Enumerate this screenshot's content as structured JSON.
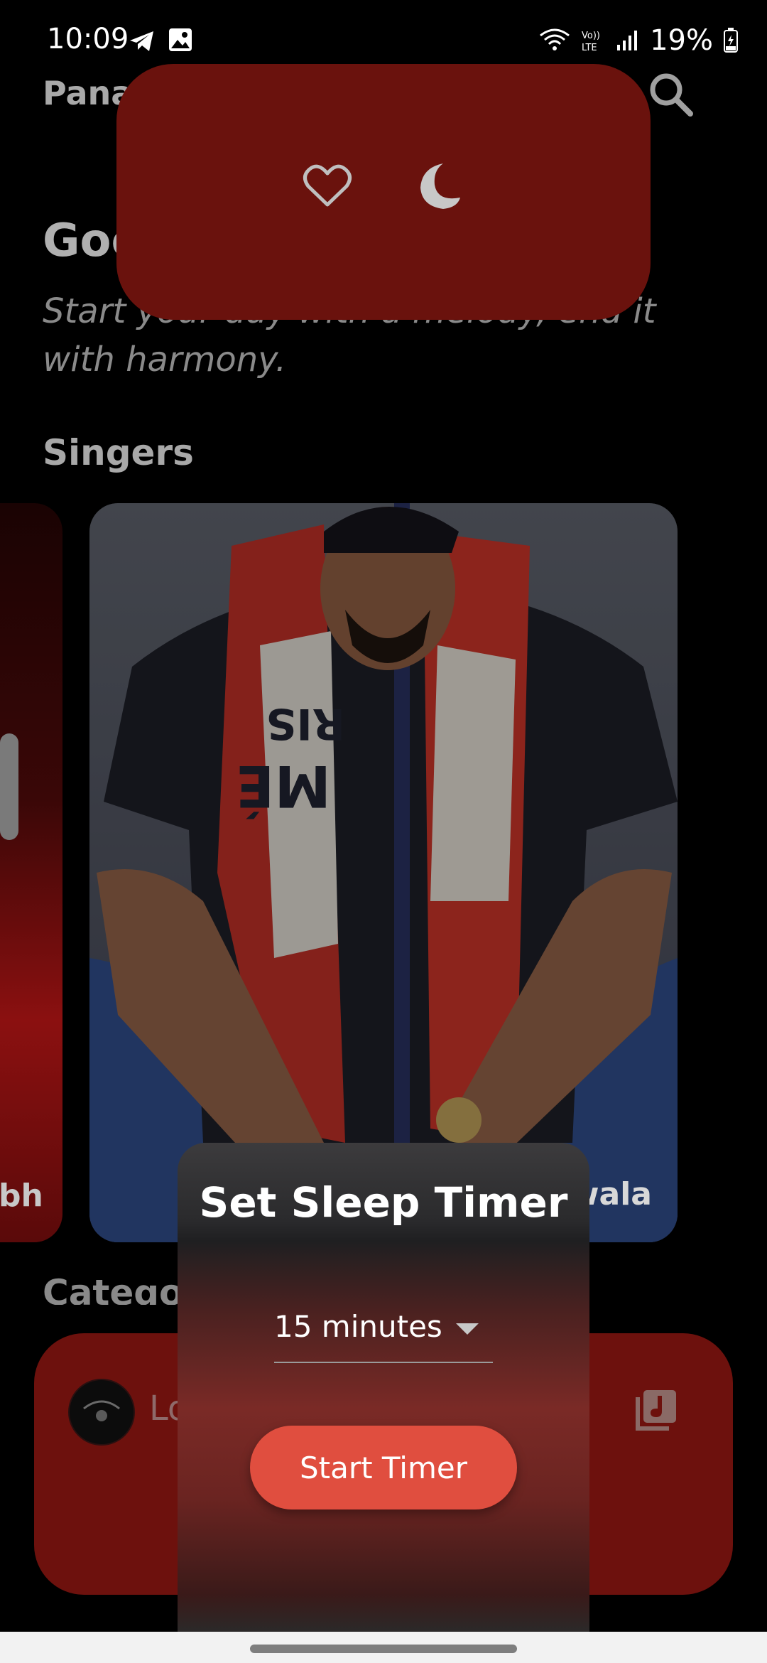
{
  "status_bar": {
    "time": "10:09",
    "battery": "19%",
    "left_icons": [
      "telegram-icon",
      "gallery-icon"
    ],
    "right_icons": [
      "wifi-icon",
      "volte-icon",
      "signal-icon",
      "battery-icon"
    ]
  },
  "app": {
    "title_visible": "Pana",
    "greeting_visible": "Goo",
    "tagline_visible_line1": "Start your day with a melody, end it",
    "tagline_visible_line2": "with harmony.",
    "sections": {
      "singers": "Singers",
      "categories_visible": "Categories"
    },
    "singers": [
      {
        "name_visible": "bh"
      },
      {
        "name_visible": "wala"
      }
    ],
    "mini_player": {
      "song_visible": "Lo",
      "icons": [
        "album-avatar",
        "music-queue-icon"
      ]
    }
  },
  "top_popup": {
    "icons": [
      "heart-icon",
      "moon-icon"
    ]
  },
  "sleep_timer": {
    "title": "Set Sleep Timer",
    "selected_duration": "15 minutes",
    "start_button": "Start Timer"
  },
  "colors": {
    "popup_red": "#6a120d",
    "button_red": "#e04e3f",
    "background": "#000000"
  }
}
